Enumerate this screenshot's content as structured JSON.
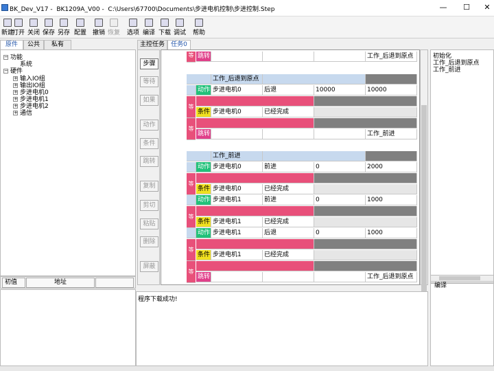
{
  "window": {
    "app": "BK_Dev_V17",
    "device": "BK1209A_V00",
    "path": "C:\\Users\\67700\\Documents\\步进电机控制\\步进控制.Step",
    "min": "—",
    "max": "☐",
    "close": "✕"
  },
  "toolbar": [
    {
      "label": "新建",
      "icon": "new-file-icon",
      "enabled": true
    },
    {
      "label": "打开",
      "icon": "open-folder-icon",
      "enabled": true
    },
    {
      "label": "关闭",
      "icon": "close-file-icon",
      "enabled": true
    },
    {
      "label": "保存",
      "icon": "save-icon",
      "enabled": true
    },
    {
      "label": "另存",
      "icon": "save-as-icon",
      "enabled": true
    },
    {
      "label": "配置",
      "icon": "wrench-icon",
      "enabled": true
    },
    {
      "label": "撤销",
      "icon": "undo-icon",
      "enabled": true
    },
    {
      "label": "恢复",
      "icon": "redo-icon",
      "enabled": false
    },
    {
      "label": "选项",
      "icon": "options-icon",
      "enabled": true
    },
    {
      "label": "编译",
      "icon": "compile-icon",
      "enabled": true
    },
    {
      "label": "下载",
      "icon": "download-icon",
      "enabled": true
    },
    {
      "label": "调试",
      "icon": "debug-icon",
      "enabled": true
    },
    {
      "label": "帮助",
      "icon": "help-icon",
      "enabled": true
    }
  ],
  "left_tabs": [
    "原件",
    "公共",
    "私有"
  ],
  "tree": {
    "function": "功能",
    "system": "系统",
    "hardware": "硬件",
    "items": [
      "输入IO组",
      "输出IO组",
      "步进电机0",
      "步进电机1",
      "步进电机2",
      "通信"
    ]
  },
  "address_bar": {
    "initial": "初值",
    "address": "地址"
  },
  "content_tabs": [
    "主控任务",
    "任务0"
  ],
  "side_buttons": [
    {
      "label": "步骤",
      "enabled": true
    },
    {
      "label": "等待",
      "enabled": false
    },
    {
      "label": "如果",
      "enabled": false
    },
    {
      "label": "动作",
      "enabled": false
    },
    {
      "label": "条件",
      "enabled": false
    },
    {
      "label": "跳转",
      "enabled": false
    },
    {
      "label": "复制",
      "enabled": false
    },
    {
      "label": "剪切",
      "enabled": false
    },
    {
      "label": "粘贴",
      "enabled": false
    },
    {
      "label": "删除",
      "enabled": false
    },
    {
      "label": "屏蔽",
      "enabled": false
    }
  ],
  "grid_text": {
    "wait": "等",
    "jump": "跳转",
    "action": "动作",
    "condition": "条件",
    "back_to_origin": "工作_后退到原点",
    "forward": "工作_前进",
    "motor0": "步进电机0",
    "motor1": "步进电机1",
    "back": "后退",
    "fwd": "前进",
    "done": "已经完成",
    "v10000": "10000",
    "v0": "0",
    "v2000": "2000",
    "v1000": "1000"
  },
  "right_panel": {
    "items": [
      "初始化",
      "工作_后退到原点",
      "工作_前进"
    ],
    "compile_label": "编译"
  },
  "output": {
    "message": "程序下载成功!"
  },
  "colors": {
    "header": "#c7d9ee",
    "wait": "#e8507a",
    "action": "#21c17a",
    "condition": "#f0e020",
    "jump_marker": "#e0408a"
  }
}
